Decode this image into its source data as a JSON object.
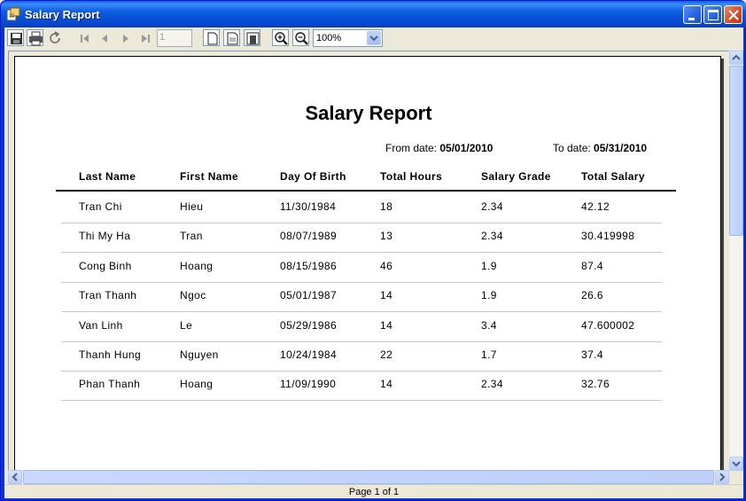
{
  "window": {
    "title": "Salary Report"
  },
  "toolbar": {
    "page_number": "1",
    "zoom": "100%"
  },
  "report": {
    "title": "Salary Report",
    "from_label": "From date:",
    "from_value": "05/01/2010",
    "to_label": "To date:",
    "to_value": "05/31/2010",
    "headers": [
      "Last Name",
      "First Name",
      "Day Of Birth",
      "Total Hours",
      "Salary Grade",
      "Total Salary"
    ],
    "rows": [
      [
        "Tran Chi",
        "Hieu",
        "11/30/1984",
        "18",
        "2.34",
        "42.12"
      ],
      [
        "Thi My Ha",
        "Tran",
        "08/07/1989",
        "13",
        "2.34",
        "30.419998"
      ],
      [
        "Cong Binh",
        "Hoang",
        "08/15/1986",
        "46",
        "1.9",
        "87.4"
      ],
      [
        "Tran Thanh",
        "Ngoc",
        "05/01/1987",
        "14",
        "1.9",
        "26.6"
      ],
      [
        "Van Linh",
        "Le",
        "05/29/1986",
        "14",
        "3.4",
        "47.600002"
      ],
      [
        "Thanh Hung",
        "Nguyen",
        "10/24/1984",
        "22",
        "1.7",
        "37.4"
      ],
      [
        "Phan Thanh",
        "Hoang",
        "11/09/1990",
        "14",
        "2.34",
        "32.76"
      ]
    ]
  },
  "status": {
    "page_text": "Page 1 of 1"
  },
  "colors": {
    "titlebar": "#0A5FE6",
    "window_bg": "#ECE9D8",
    "page_bg": "#FFFFFF"
  }
}
